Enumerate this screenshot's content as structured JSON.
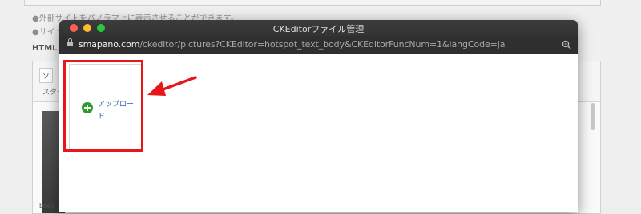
{
  "background": {
    "note_1": "●外部サイトをパノラマ上に表示させることができます。",
    "note_2": "●サイト",
    "heading": "HTML",
    "toolbar_label": "ソ",
    "toolbar_label_2": "スタイ",
    "body_text": "body"
  },
  "window": {
    "title": "CKEditorファイル管理",
    "url_domain": "smapano.com",
    "url_path": "/ckeditor/pictures?CKEditor=hotspot_text_body&CKEditorFuncNum=1&langCode=ja"
  },
  "upload": {
    "label": "アップロード",
    "icon": "plus-circle-icon"
  },
  "colors": {
    "highlight": "#e8151b",
    "accent_green": "#2d9a2d",
    "link_blue": "#2a5db0"
  }
}
